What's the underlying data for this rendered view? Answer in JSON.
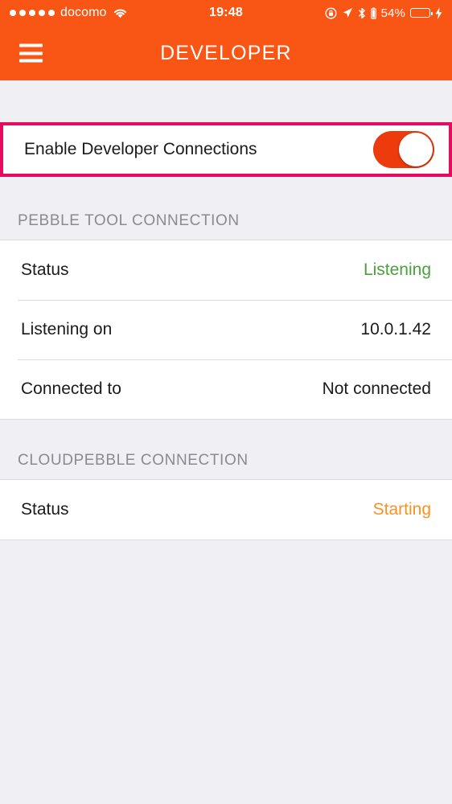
{
  "status_bar": {
    "signal_dots": 5,
    "carrier": "docomo",
    "wifi_icon": "wifi-icon",
    "time": "19:48",
    "rotation_lock_icon": "rotation-lock-icon",
    "location_icon": "location-arrow-icon",
    "bluetooth_icon": "bluetooth-icon",
    "bluetooth_battery_icon": "bluetooth-battery-icon",
    "battery_percent": "54%",
    "battery_fill_pct": 54,
    "charging_icon": "lightning-bolt-icon"
  },
  "nav_bar": {
    "menu_icon": "hamburger-menu-icon",
    "title": "DEVELOPER"
  },
  "developer_toggle": {
    "label": "Enable Developer Connections",
    "state": "on",
    "highlighted": true
  },
  "sections": [
    {
      "header": "PEBBLE TOOL CONNECTION",
      "rows": [
        {
          "label": "Status",
          "value": "Listening",
          "value_style": "green"
        },
        {
          "label": "Listening on",
          "value": "10.0.1.42",
          "value_style": "plain"
        },
        {
          "label": "Connected to",
          "value": "Not connected",
          "value_style": "plain"
        }
      ]
    },
    {
      "header": "CLOUDPEBBLE CONNECTION",
      "rows": [
        {
          "label": "Status",
          "value": "Starting",
          "value_style": "orange"
        }
      ]
    }
  ],
  "colors": {
    "brand_orange": "#F95514",
    "toggle_on": "#EE3B0D",
    "highlight_pink": "#E50B5E",
    "status_green": "#4CA03C",
    "status_orange": "#F99123",
    "background_gray": "#EFEFF4",
    "header_text_gray": "#8A8A8F"
  }
}
